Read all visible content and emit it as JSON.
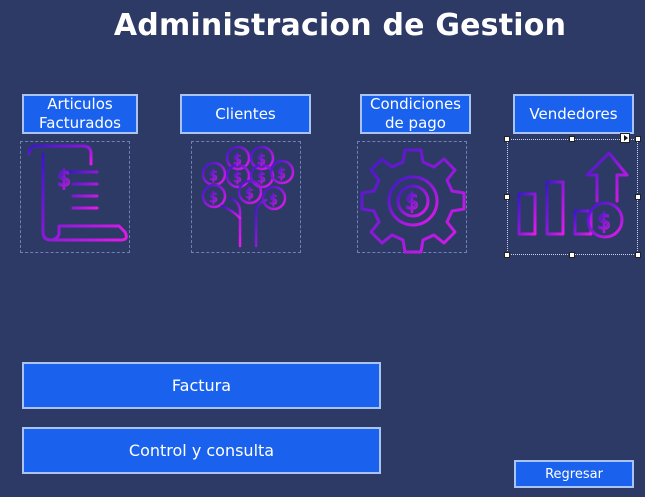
{
  "header": {
    "title": "Administracion de Gestion"
  },
  "modules": [
    {
      "label": "Articulos\nFacturados",
      "icon": "invoice-scroll-icon"
    },
    {
      "label": "Clientes",
      "icon": "money-tree-icon"
    },
    {
      "label": "Condiciones\nde pago",
      "icon": "money-gear-icon"
    },
    {
      "label": "Vendedores",
      "icon": "sales-growth-chart-icon"
    }
  ],
  "actions": {
    "factura_label": "Factura",
    "control_label": "Control y consulta",
    "back_label": "Regresar"
  },
  "colors": {
    "background": "#2e3a66",
    "button": "#1a62ee",
    "button_border": "#a9c4f2",
    "icon_gradient_start": "#3a17c8",
    "icon_gradient_end": "#e21bea"
  }
}
